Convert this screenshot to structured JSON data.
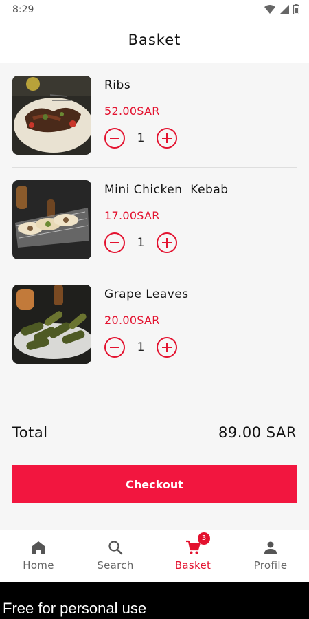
{
  "status_bar": {
    "time": "8:29",
    "icons": [
      "wifi-icon",
      "signal-icon",
      "battery-icon"
    ]
  },
  "header": {
    "title": "Basket"
  },
  "basket": {
    "items": [
      {
        "name": "Ribs",
        "price": "52.00SAR",
        "quantity": "1",
        "image": "ribs-photo"
      },
      {
        "name": "Mini Chicken  Kebab",
        "price": "17.00SAR",
        "quantity": "1",
        "image": "chicken-kebab-photo"
      },
      {
        "name": "Grape Leaves",
        "price": "20.00SAR",
        "quantity": "1",
        "image": "grape-leaves-photo"
      }
    ],
    "total_label": "Total",
    "total_value": "89.00 SAR",
    "checkout_label": "Checkout"
  },
  "nav": {
    "items": [
      {
        "label": "Home",
        "icon": "home-icon"
      },
      {
        "label": "Search",
        "icon": "search-icon"
      },
      {
        "label": "Basket",
        "icon": "cart-icon",
        "badge": "3",
        "active": true
      },
      {
        "label": "Profile",
        "icon": "person-icon"
      }
    ]
  },
  "footer": {
    "text": "Free for personal use"
  },
  "colors": {
    "accent": "#e3122f",
    "checkout": "#f2163f"
  }
}
